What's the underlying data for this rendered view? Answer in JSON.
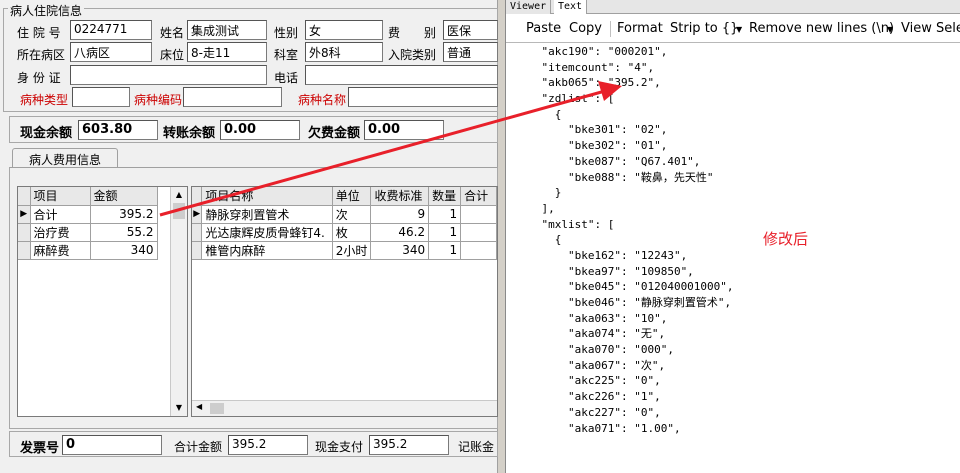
{
  "patient_info": {
    "group_title": "病人住院信息",
    "admission_no_label": "住 院 号",
    "admission_no": "0224771",
    "name_label": "姓名",
    "name": "集成测试",
    "gender_label": "性别",
    "gender": "女",
    "fee_type_label": "费　　别",
    "fee_type": "医保",
    "ward_label": "所在病区",
    "ward": "八病区",
    "bed_label": "床位",
    "bed": "8-走11",
    "dept_label": "科室",
    "dept": "外8科",
    "admit_type_label": "入院类别",
    "admit_type": "普通",
    "id_label": "身 份 证",
    "id_value": "",
    "phone_label": "电话",
    "phone_value": "",
    "disease_type_label": "病种类型",
    "disease_type": "",
    "disease_code_label": "病种编码",
    "disease_code": "",
    "disease_name_label": "病种名称",
    "disease_name": ""
  },
  "balance": {
    "cash_label": "现金余额",
    "cash": "603.80",
    "transfer_label": "转账余额",
    "transfer": "0.00",
    "owed_label": "欠费金额",
    "owed": "0.00"
  },
  "fee_tab": {
    "label": "病人费用信息"
  },
  "summary_grid": {
    "headers": [
      "项目",
      "金额"
    ],
    "rows": [
      {
        "item": "合计",
        "amount": "395.2",
        "selected": true
      },
      {
        "item": "治疗费",
        "amount": "55.2"
      },
      {
        "item": "麻醉费",
        "amount": "340"
      }
    ]
  },
  "detail_grid": {
    "headers": [
      "项目名称",
      "单位",
      "收费标准",
      "数量",
      "合计"
    ],
    "rows": [
      {
        "name": "静脉穿刺置管术",
        "unit": "次",
        "price": "9",
        "qty": "1",
        "total": ""
      },
      {
        "name": "光达康辉皮质骨蜂钉4.",
        "unit": "枚",
        "price": "46.2",
        "qty": "1",
        "total": ""
      },
      {
        "name": "椎管内麻醉",
        "unit": "2小时",
        "price": "340",
        "qty": "1",
        "total": ""
      }
    ]
  },
  "footer": {
    "invoice_label": "发票号",
    "invoice": "0",
    "total_label": "合计金额",
    "total": "395.2",
    "cash_pay_label": "现金支付",
    "cash_pay": "395.2",
    "account_label": "记账金"
  },
  "viewer": {
    "tabs": [
      "Viewer",
      "Text"
    ],
    "active_tab": "Text",
    "toolbar": {
      "paste": "Paste",
      "copy": "Copy",
      "format": "Format",
      "strip": "Strip to {}",
      "remove_newlines": "Remove new lines (\\n)",
      "view_select": "View Selec"
    },
    "code_lines": [
      "    \"akc190\": \"000201\",",
      "    \"itemcount\": \"4\",",
      "    \"akb065\": \"395.2\",",
      "    \"zdlist\": [",
      "      {",
      "        \"bke301\": \"02\",",
      "        \"bke302\": \"01\",",
      "        \"bke087\": \"Q67.401\",",
      "        \"bke088\": \"鞍鼻，先天性\"",
      "      }",
      "    ],",
      "    \"mxlist\": [",
      "      {",
      "        \"bke162\": \"12243\",",
      "        \"bkea97\": \"109850\",",
      "        \"bke045\": \"012040001000\",",
      "        \"bke046\": \"静脉穿刺置管术\",",
      "        \"aka063\": \"10\",",
      "        \"aka074\": \"无\",",
      "        \"aka070\": \"000\",",
      "        \"aka067\": \"次\",",
      "        \"akc225\": \"0\",",
      "        \"akc226\": \"1\",",
      "        \"akc227\": \"0\",",
      "        \"aka071\": \"1.00\","
    ]
  },
  "annotation": {
    "text": "修改后",
    "color": "#e8202a"
  }
}
